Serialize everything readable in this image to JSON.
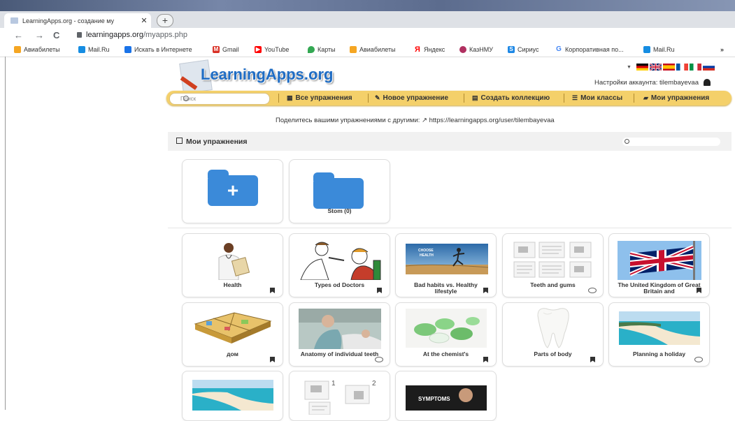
{
  "browser": {
    "tab_title": "LearningApps.org - создание му",
    "tab_close": "✕",
    "new_tab": "+",
    "nav_back": "←",
    "nav_forward": "→",
    "nav_reload": "C",
    "url_domain": "learningapps.org",
    "url_path": "/myapps.php",
    "bookmarks": [
      {
        "label": "Авиабилеты",
        "color": "#f5a623"
      },
      {
        "label": "Mail.Ru",
        "color": "#168de2"
      },
      {
        "label": "Искать в Интернете",
        "color": "#1a73e8"
      },
      {
        "label": "Gmail",
        "color": "#d93025"
      },
      {
        "label": "YouTube",
        "color": "#ff0000"
      },
      {
        "label": "Карты",
        "color": "#34a853"
      },
      {
        "label": "Авиабилеты",
        "color": "#f5a623"
      },
      {
        "label": "Яндекс",
        "color": "#ff0000"
      },
      {
        "label": "КазНМУ",
        "color": "#b03060"
      },
      {
        "label": "Сириус",
        "color": "#1e88e5"
      },
      {
        "label": "Корпоративная по...",
        "color": "#4285f4"
      },
      {
        "label": "Mail.Ru",
        "color": "#168de2"
      }
    ],
    "bookmarks_more": "»"
  },
  "site": {
    "logo_text": "LearningApps.org",
    "account_label": "Настройки аккаунта: tilembayevaa",
    "search_placeholder": "Поиск",
    "menu": [
      {
        "icon": "▦",
        "label": "Все упражнения"
      },
      {
        "icon": "✎",
        "label": "Новое упражнение"
      },
      {
        "icon": "▤",
        "label": "Создать коллекцию"
      },
      {
        "icon": "☰",
        "label": "Мои классы"
      },
      {
        "icon": "▰",
        "label": "Мои упражнения"
      }
    ],
    "share_text": "Поделитесь вашими упражнениями с другими: ↗ https://learningapps.org/user/tilembayevaa",
    "panel_title": "Мои упражнения",
    "folder_label": "Stom (0)",
    "apps": [
      {
        "label": "Health",
        "mark": "flag"
      },
      {
        "label": "Types od Doctors",
        "mark": "flag"
      },
      {
        "label": "Bad habits vs. Healthy lifestyle",
        "mark": "flag"
      },
      {
        "label": "Teeth and gums",
        "mark": "eye"
      },
      {
        "label": "The United Kingdom of Great Britain and",
        "mark": "flag"
      },
      {
        "label": "дом",
        "mark": "flag"
      },
      {
        "label": "Anatomy of individual teeth",
        "mark": "eye"
      },
      {
        "label": "At the chemist's",
        "mark": "flag"
      },
      {
        "label": "Parts of body",
        "mark": "flag"
      },
      {
        "label": "Planning a holiday",
        "mark": "eye"
      }
    ],
    "thumb_text_bad_habits_1": "CHOOSE",
    "thumb_text_bad_habits_2": "HEALTH",
    "thumb_text_symptoms": "SYMPTOMS",
    "thumb_num_1": "1",
    "thumb_num_2": "2"
  }
}
